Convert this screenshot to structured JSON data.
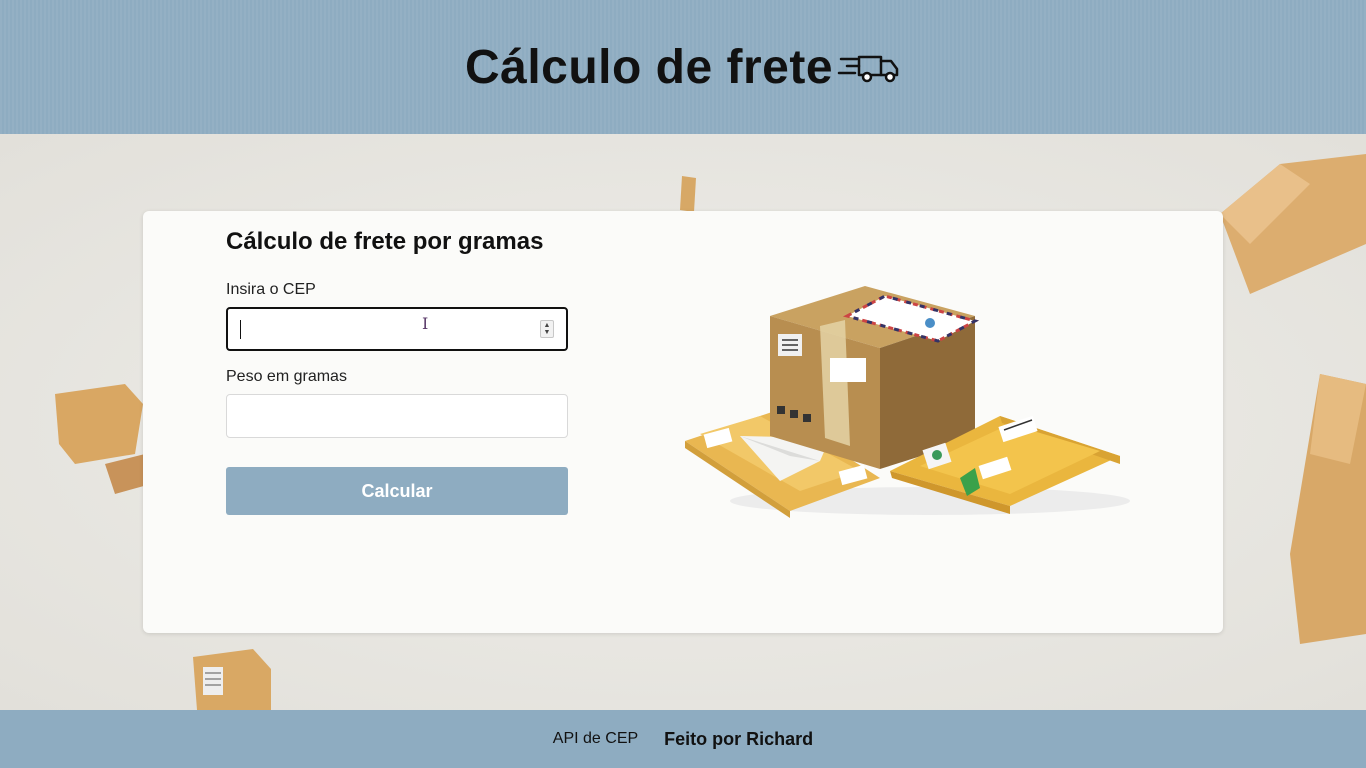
{
  "header": {
    "title": "Cálculo de frete"
  },
  "form": {
    "title": "Cálculo de frete por gramas",
    "cep_label": "Insira o CEP",
    "cep_value": "",
    "peso_label": "Peso em gramas",
    "peso_value": "",
    "submit_label": "Calcular"
  },
  "footer": {
    "api_link": "API de CEP",
    "credit": "Feito por Richard"
  },
  "colors": {
    "brand": "#8eacc1",
    "card": "#fbfbf9",
    "text": "#111111"
  },
  "icons": [
    "truck-icon",
    "spinner-icon",
    "text-cursor-icon",
    "packages-illustration"
  ]
}
